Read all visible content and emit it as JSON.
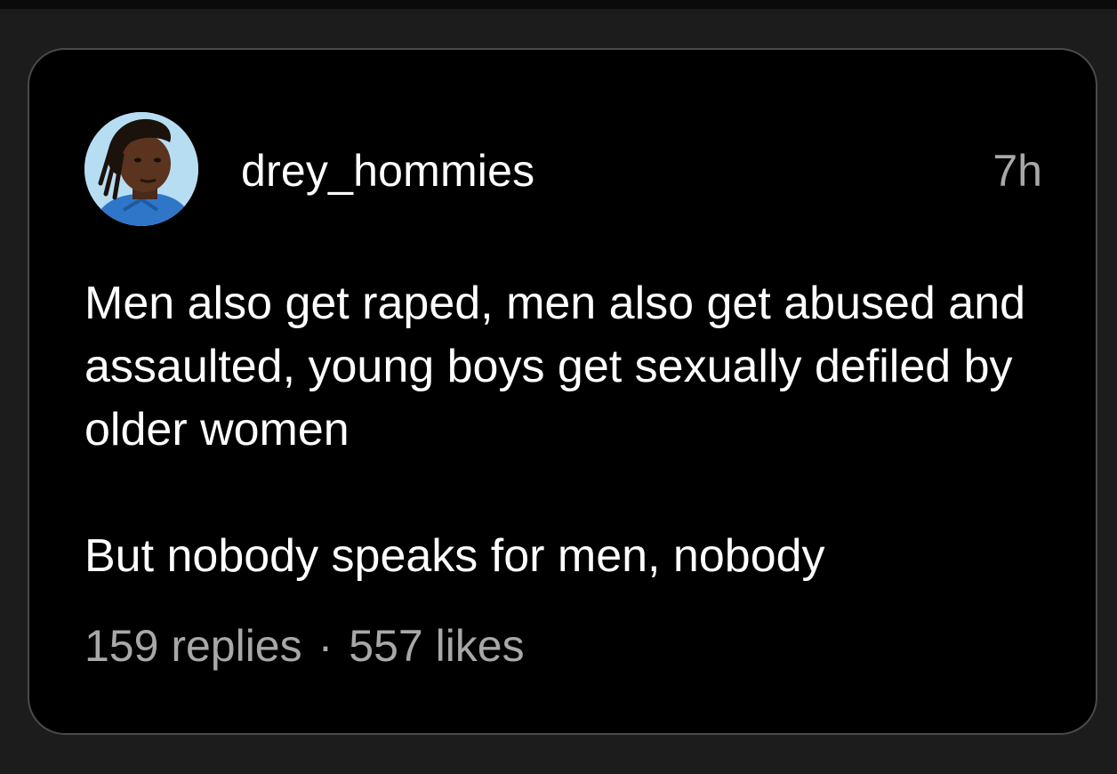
{
  "post": {
    "username": "drey_hommies",
    "time": "7h",
    "paragraphs": [
      "Men also get raped, men also get abused and assaulted, young boys get sexually defiled by older women",
      "But nobody speaks for men, nobody"
    ],
    "replies": "159 replies",
    "separator": "·",
    "likes": "557 likes"
  },
  "colors": {
    "page_background": "#1c1c1c",
    "card_background": "#000000",
    "card_border": "#4a4a4a",
    "primary_text": "#ffffff",
    "secondary_text": "#a8a8a8"
  },
  "icons": {
    "avatar": "user-avatar-photo"
  }
}
